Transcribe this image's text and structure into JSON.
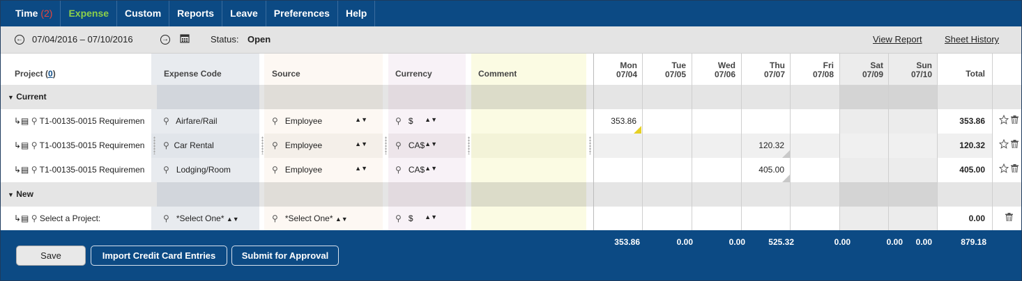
{
  "nav": {
    "items": [
      "Time",
      "Expense",
      "Custom",
      "Reports",
      "Leave",
      "Preferences",
      "Help"
    ],
    "time_count": "(2)"
  },
  "toolbar": {
    "prev_icon": "circle-arrow-left-icon",
    "date_range": "07/04/2016 – 07/10/2016",
    "next_icon": "circle-arrow-right-icon",
    "calendar_icon": "calendar-icon",
    "status_label": "Status:",
    "status_value": "Open",
    "view_report": "View Report",
    "sheet_history": "Sheet History"
  },
  "header": {
    "project": "Project (",
    "project_count": "0",
    "project_close": ")",
    "expense_code": "Expense Code",
    "source": "Source",
    "currency": "Currency",
    "comment": "Comment",
    "days": [
      {
        "dow": "Mon",
        "date": "07/04"
      },
      {
        "dow": "Tue",
        "date": "07/05"
      },
      {
        "dow": "Wed",
        "date": "07/06"
      },
      {
        "dow": "Thu",
        "date": "07/07"
      },
      {
        "dow": "Fri",
        "date": "07/08"
      },
      {
        "dow": "Sat",
        "date": "07/09"
      },
      {
        "dow": "Sun",
        "date": "07/10"
      }
    ],
    "total": "Total"
  },
  "groups": {
    "current": "Current",
    "new": "New"
  },
  "rows": [
    {
      "project": "T1-00135-0015 Requiremen",
      "code": "Airfare/Rail",
      "source": "Employee",
      "currency": "$",
      "days": [
        "353.86",
        "",
        "",
        "",
        "",
        "",
        ""
      ],
      "total": "353.86"
    },
    {
      "project": "T1-00135-0015 Requiremen",
      "code": "Car Rental",
      "source": "Employee",
      "currency": "CA$",
      "days": [
        "",
        "",
        "",
        "120.32",
        "",
        "",
        ""
      ],
      "total": "120.32"
    },
    {
      "project": "T1-00135-0015 Requiremen",
      "code": "Lodging/Room",
      "source": "Employee",
      "currency": "CA$",
      "days": [
        "",
        "",
        "",
        "405.00",
        "",
        "",
        ""
      ],
      "total": "405.00"
    }
  ],
  "new_row": {
    "project": "Select a Project:",
    "code": "*Select One*",
    "source": "*Select One*",
    "currency": "$",
    "total": "0.00"
  },
  "footer": {
    "save": "Save",
    "import": "Import Credit Card Entries",
    "submit": "Submit for Approval",
    "totals": [
      "353.86",
      "0.00",
      "0.00",
      "525.32",
      "0.00",
      "0.00",
      "0.00"
    ],
    "grand_total": "879.18"
  },
  "icons": {
    "row_link": "subproject-link-icon",
    "search": "magnifier-icon",
    "favorite": "star-icon",
    "delete": "trash-icon",
    "collapse": "triangle-down-icon"
  },
  "colors": {
    "nav_bg": "#0c4a84",
    "active_tab": "#8cd04a",
    "count": "#e8453c",
    "comment_bg": "#fbfbe3"
  }
}
